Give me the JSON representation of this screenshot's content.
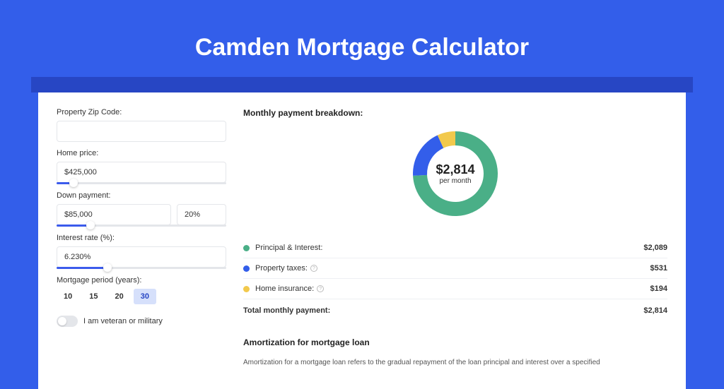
{
  "title": "Camden Mortgage Calculator",
  "form": {
    "zip_label": "Property Zip Code:",
    "zip_value": "",
    "home_price_label": "Home price:",
    "home_price_value": "$425,000",
    "home_slider_pct": 10,
    "down_label": "Down payment:",
    "down_value": "$85,000",
    "down_pct": "20%",
    "down_slider_pct": 20,
    "rate_label": "Interest rate (%):",
    "rate_value": "6.230%",
    "rate_slider_pct": 30,
    "period_label": "Mortgage period (years):",
    "periods": [
      "10",
      "15",
      "20",
      "30"
    ],
    "period_selected": "30",
    "toggle_label": "I am veteran or military"
  },
  "breakdown": {
    "heading": "Monthly payment breakdown:",
    "center_value": "$2,814",
    "center_sub": "per month",
    "items": [
      {
        "label": "Principal & Interest:",
        "value": "$2,089",
        "color": "#4aaf87",
        "info": false
      },
      {
        "label": "Property taxes:",
        "value": "$531",
        "color": "#335eea",
        "info": true
      },
      {
        "label": "Home insurance:",
        "value": "$194",
        "color": "#f2c94c",
        "info": true
      }
    ],
    "total_label": "Total monthly payment:",
    "total_value": "$2,814"
  },
  "chart_data": {
    "type": "pie",
    "title": "Monthly payment breakdown",
    "series": [
      {
        "name": "Principal & Interest",
        "value": 2089,
        "color": "#4aaf87"
      },
      {
        "name": "Property taxes",
        "value": 531,
        "color": "#335eea"
      },
      {
        "name": "Home insurance",
        "value": 194,
        "color": "#f2c94c"
      }
    ],
    "total": 2814,
    "donut": true
  },
  "amort": {
    "heading": "Amortization for mortgage loan",
    "text": "Amortization for a mortgage loan refers to the gradual repayment of the loan principal and interest over a specified"
  }
}
